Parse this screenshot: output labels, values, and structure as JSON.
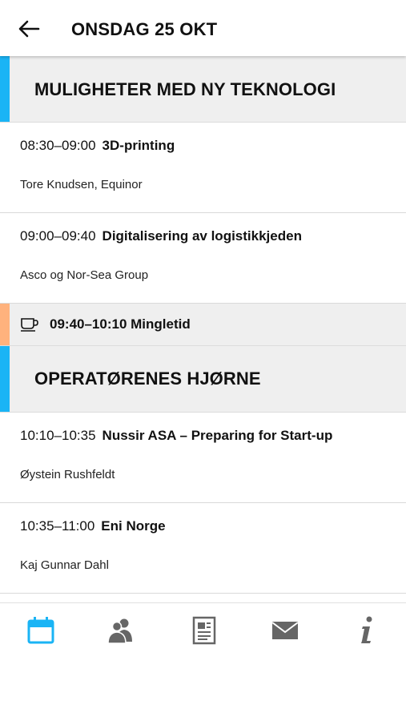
{
  "header": {
    "title": "ONSDAG 25 OKT"
  },
  "colors": {
    "accent": "#1ab4f5",
    "break_accent": "#ffb27d",
    "icon_gray": "#666666"
  },
  "sections": [
    {
      "title": "MULIGHETER MED NY TEKNOLOGI",
      "sessions": [
        {
          "time": "08:30–09:00",
          "title": "3D-printing",
          "speaker": "Tore Knudsen, Equinor"
        },
        {
          "time": "09:00–09:40",
          "title": "Digitalisering av logistikkjeden",
          "speaker": "Asco og Nor-Sea Group"
        }
      ]
    },
    {
      "title": "OPERATØRENES HJØRNE",
      "sessions": [
        {
          "time": "10:10–10:35",
          "title": "Nussir ASA – Preparing for Start-up",
          "speaker": "Øystein Rushfeldt"
        },
        {
          "time": "10:35–11:00",
          "title": "Eni Norge",
          "speaker": "Kaj Gunnar Dahl"
        }
      ]
    }
  ],
  "break_item": {
    "text": "09:40–10:10 Mingletid",
    "icon": "coffee-cup-icon"
  },
  "bottom_nav": [
    {
      "icon": "calendar-icon",
      "active": true
    },
    {
      "icon": "people-icon",
      "active": false
    },
    {
      "icon": "document-icon",
      "active": false
    },
    {
      "icon": "mail-icon",
      "active": false
    },
    {
      "icon": "info-icon",
      "active": false
    }
  ]
}
